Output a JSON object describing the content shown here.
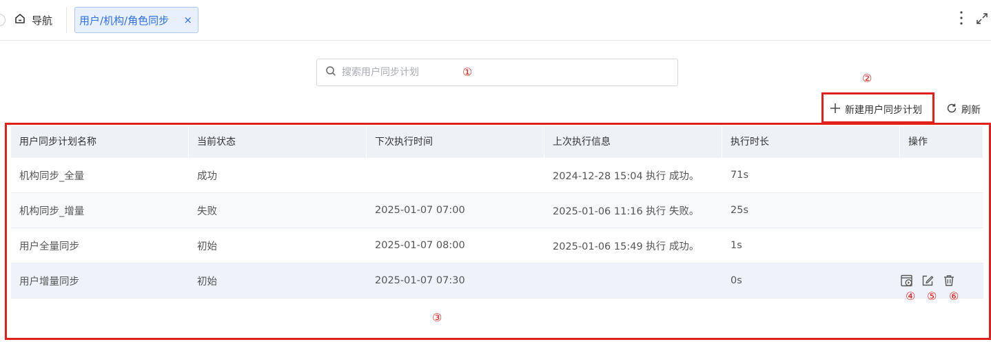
{
  "topbar": {
    "home_label": "导航",
    "active_tab": "用户/机构/角色同步",
    "close_glyph": "×"
  },
  "search": {
    "placeholder": "搜索用户同步计划",
    "value": ""
  },
  "toolbar": {
    "create_label": "新建用户同步计划",
    "refresh_label": "刷新"
  },
  "table": {
    "columns": [
      "用户同步计划名称",
      "当前状态",
      "下次执行时间",
      "上次执行信息",
      "执行时长",
      "操作"
    ],
    "rows": [
      [
        "机构同步_全量",
        "成功",
        "",
        "2024-12-28 15:04 执行 成功。",
        "71s"
      ],
      [
        "机构同步_增量",
        "失败",
        "2025-01-07 07:00",
        "2025-01-06 11:16 执行 失败。",
        "25s"
      ],
      [
        "用户全量同步",
        "初始",
        "2025-01-07 08:00",
        "2025-01-06 15:49 执行 成功。",
        "1s"
      ],
      [
        "用户增量同步",
        "初始",
        "2025-01-07 07:30",
        "",
        "0s"
      ]
    ]
  },
  "markers": {
    "m1": "①",
    "m2": "②",
    "m3": "③",
    "m4": "④",
    "m5": "⑤",
    "m6": "⑥"
  },
  "icons": [
    "home-icon",
    "close-icon",
    "more-vertical-icon",
    "expand-icon",
    "search-icon",
    "plus-icon",
    "refresh-icon",
    "run-icon",
    "edit-icon",
    "delete-icon"
  ],
  "colors": {
    "accent": "#2f6fe4",
    "annotation": "#e0201b",
    "header_bg": "#eef1f6"
  }
}
